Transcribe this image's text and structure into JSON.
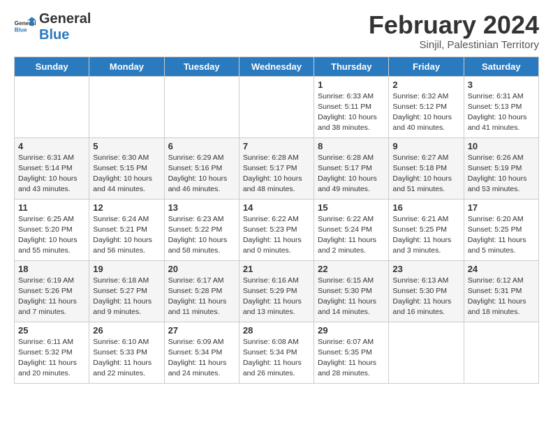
{
  "header": {
    "logo_general": "General",
    "logo_blue": "Blue",
    "month_title": "February 2024",
    "location": "Sinjil, Palestinian Territory"
  },
  "days_of_week": [
    "Sunday",
    "Monday",
    "Tuesday",
    "Wednesday",
    "Thursday",
    "Friday",
    "Saturday"
  ],
  "weeks": [
    [
      {
        "day": "",
        "info": ""
      },
      {
        "day": "",
        "info": ""
      },
      {
        "day": "",
        "info": ""
      },
      {
        "day": "",
        "info": ""
      },
      {
        "day": "1",
        "info": "Sunrise: 6:33 AM\nSunset: 5:11 PM\nDaylight: 10 hours\nand 38 minutes."
      },
      {
        "day": "2",
        "info": "Sunrise: 6:32 AM\nSunset: 5:12 PM\nDaylight: 10 hours\nand 40 minutes."
      },
      {
        "day": "3",
        "info": "Sunrise: 6:31 AM\nSunset: 5:13 PM\nDaylight: 10 hours\nand 41 minutes."
      }
    ],
    [
      {
        "day": "4",
        "info": "Sunrise: 6:31 AM\nSunset: 5:14 PM\nDaylight: 10 hours\nand 43 minutes."
      },
      {
        "day": "5",
        "info": "Sunrise: 6:30 AM\nSunset: 5:15 PM\nDaylight: 10 hours\nand 44 minutes."
      },
      {
        "day": "6",
        "info": "Sunrise: 6:29 AM\nSunset: 5:16 PM\nDaylight: 10 hours\nand 46 minutes."
      },
      {
        "day": "7",
        "info": "Sunrise: 6:28 AM\nSunset: 5:17 PM\nDaylight: 10 hours\nand 48 minutes."
      },
      {
        "day": "8",
        "info": "Sunrise: 6:28 AM\nSunset: 5:17 PM\nDaylight: 10 hours\nand 49 minutes."
      },
      {
        "day": "9",
        "info": "Sunrise: 6:27 AM\nSunset: 5:18 PM\nDaylight: 10 hours\nand 51 minutes."
      },
      {
        "day": "10",
        "info": "Sunrise: 6:26 AM\nSunset: 5:19 PM\nDaylight: 10 hours\nand 53 minutes."
      }
    ],
    [
      {
        "day": "11",
        "info": "Sunrise: 6:25 AM\nSunset: 5:20 PM\nDaylight: 10 hours\nand 55 minutes."
      },
      {
        "day": "12",
        "info": "Sunrise: 6:24 AM\nSunset: 5:21 PM\nDaylight: 10 hours\nand 56 minutes."
      },
      {
        "day": "13",
        "info": "Sunrise: 6:23 AM\nSunset: 5:22 PM\nDaylight: 10 hours\nand 58 minutes."
      },
      {
        "day": "14",
        "info": "Sunrise: 6:22 AM\nSunset: 5:23 PM\nDaylight: 11 hours\nand 0 minutes."
      },
      {
        "day": "15",
        "info": "Sunrise: 6:22 AM\nSunset: 5:24 PM\nDaylight: 11 hours\nand 2 minutes."
      },
      {
        "day": "16",
        "info": "Sunrise: 6:21 AM\nSunset: 5:25 PM\nDaylight: 11 hours\nand 3 minutes."
      },
      {
        "day": "17",
        "info": "Sunrise: 6:20 AM\nSunset: 5:25 PM\nDaylight: 11 hours\nand 5 minutes."
      }
    ],
    [
      {
        "day": "18",
        "info": "Sunrise: 6:19 AM\nSunset: 5:26 PM\nDaylight: 11 hours\nand 7 minutes."
      },
      {
        "day": "19",
        "info": "Sunrise: 6:18 AM\nSunset: 5:27 PM\nDaylight: 11 hours\nand 9 minutes."
      },
      {
        "day": "20",
        "info": "Sunrise: 6:17 AM\nSunset: 5:28 PM\nDaylight: 11 hours\nand 11 minutes."
      },
      {
        "day": "21",
        "info": "Sunrise: 6:16 AM\nSunset: 5:29 PM\nDaylight: 11 hours\nand 13 minutes."
      },
      {
        "day": "22",
        "info": "Sunrise: 6:15 AM\nSunset: 5:30 PM\nDaylight: 11 hours\nand 14 minutes."
      },
      {
        "day": "23",
        "info": "Sunrise: 6:13 AM\nSunset: 5:30 PM\nDaylight: 11 hours\nand 16 minutes."
      },
      {
        "day": "24",
        "info": "Sunrise: 6:12 AM\nSunset: 5:31 PM\nDaylight: 11 hours\nand 18 minutes."
      }
    ],
    [
      {
        "day": "25",
        "info": "Sunrise: 6:11 AM\nSunset: 5:32 PM\nDaylight: 11 hours\nand 20 minutes."
      },
      {
        "day": "26",
        "info": "Sunrise: 6:10 AM\nSunset: 5:33 PM\nDaylight: 11 hours\nand 22 minutes."
      },
      {
        "day": "27",
        "info": "Sunrise: 6:09 AM\nSunset: 5:34 PM\nDaylight: 11 hours\nand 24 minutes."
      },
      {
        "day": "28",
        "info": "Sunrise: 6:08 AM\nSunset: 5:34 PM\nDaylight: 11 hours\nand 26 minutes."
      },
      {
        "day": "29",
        "info": "Sunrise: 6:07 AM\nSunset: 5:35 PM\nDaylight: 11 hours\nand 28 minutes."
      },
      {
        "day": "",
        "info": ""
      },
      {
        "day": "",
        "info": ""
      }
    ]
  ]
}
